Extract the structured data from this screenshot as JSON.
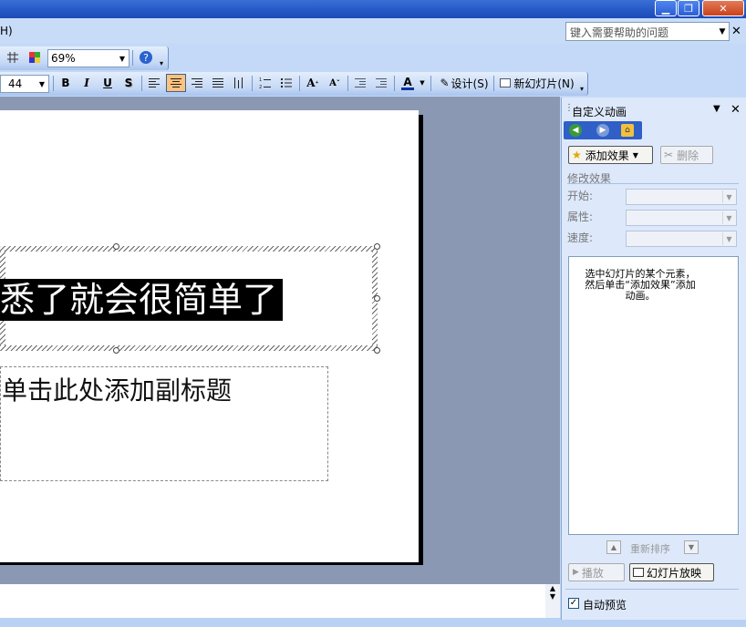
{
  "window": {
    "min_label": "▁",
    "restore_label": "❐",
    "close_label": "✕"
  },
  "menubar": {
    "help_menu_fragment": "H)",
    "help_placeholder": "键入需要帮助的问题",
    "close_label": "✕"
  },
  "toolbar_standard": {
    "zoom_value": "69%",
    "help_icon": "question-icon"
  },
  "toolbar_formatting": {
    "font_size": "44",
    "bold": "B",
    "italic": "I",
    "underline": "U",
    "shadow": "S",
    "font_color_label": "A",
    "design_button": "设计(S)",
    "new_slide_button": "新幻灯片(N)"
  },
  "slide": {
    "title_text": "悉了就会很简单了",
    "subtitle_placeholder": "单击此处添加副标题"
  },
  "task_pane": {
    "title": "自定义动画",
    "add_effect_button": "添加效果",
    "remove_button": "删除",
    "modify_section": "修改效果",
    "start_label": "开始:",
    "property_label": "属性:",
    "speed_label": "速度:",
    "list_hint": "选中幻灯片的某个元素，然后单击“添加效果”添加动画。",
    "reorder_label": "重新排序",
    "play_button": "播放",
    "slideshow_button": "幻灯片放映",
    "autopreview_label": "自动预览",
    "autopreview_checked": true
  }
}
